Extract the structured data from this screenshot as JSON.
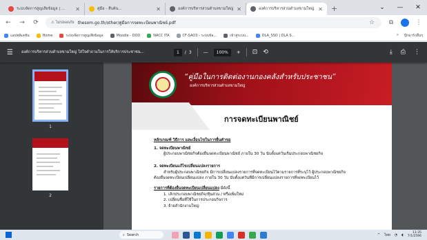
{
  "tabs": [
    {
      "title": "ระบบจัดการสูญเสียข้อมูล | ...",
      "color": "#e8453c",
      "active": false
    },
    {
      "title": "คู่มือ - สืบค้น...",
      "color": "#fbbc04",
      "active": false
    },
    {
      "title": "องค์การบริหารส่วนตำบลขามใหญ่ ...",
      "color": "#5f6368",
      "active": false
    },
    {
      "title": "องค์การบริหารส่วนตำบลขามใหญ่ ...",
      "color": "#5f6368",
      "active": true
    }
  ],
  "new_tab_glyph": "+",
  "window_controls": {
    "minimize": "⌄",
    "maximize": "—",
    "close": "✕"
  },
  "nav": {
    "back": "←",
    "forward": "→",
    "reload": "⟳",
    "secure_label": "⚠ ไม่ปลอดภัย",
    "url": "thesom.go.th/other/คู่มือการจดทะเบียนพาณิชย์.pdf",
    "star": "☆",
    "extensions": "⧉",
    "menu": "⋮"
  },
  "bookmarks": {
    "items": [
      {
        "label": "แอปพลิเคชัน",
        "color": "#4285f4"
      },
      {
        "label": "Home",
        "color": "#fbbc04"
      },
      {
        "label": "ระบบจัดการสูญเสียข้อมูล",
        "color": "#e8453c"
      },
      {
        "label": "Moodle - DOD",
        "color": "#5f6368"
      },
      {
        "label": "NACC ITA",
        "color": "#34a853"
      },
      {
        "label": "CF-SAO3 - ระบบข้อ...",
        "color": "#9aa0a6"
      },
      {
        "label": "เข้าสู่ระบบ...",
        "color": "#5f6368"
      },
      {
        "label": "DLA_SSO | DLA S...",
        "color": "#4285f4"
      }
    ],
    "more": "»",
    "other": "บุ๊กมาร์กอื่นๆ"
  },
  "pdf_toolbar": {
    "menu": "☰",
    "title": "องค์การบริหารส่วนตำบลขามใหญ่ ใส่ใจคำถามในการให้บริการประชาชน...",
    "page_current": "1",
    "page_sep": "/",
    "page_total": "3",
    "zoom_out": "—",
    "zoom": "100%",
    "zoom_in": "+",
    "fit": "⊡",
    "rotate": "⟲",
    "download": "⤓",
    "print": "⎙",
    "more": "⋮"
  },
  "thumbnails": [
    {
      "number": "1"
    },
    {
      "number": "2"
    }
  ],
  "document": {
    "banner_title": "“คู่มือในการติดต่องานกองคลังสำหรับประชาชน”",
    "banner_subtitle": "องค์การบริหารส่วนตำบลขามใหญ่",
    "section_title": "การจดทะเบียนพาณิชย์",
    "heading": "หลักเกณฑ์ วิธีการ และเงื่อนไขในการยื่นคำขอ",
    "item1_title": "1. จดทะเบียนพาณิชย์",
    "item1_text": "ผู้ประกอบพาณิชยกิจต้องยื่นจดทะเบียนพาณิชย์ ภายใน 30 วัน นับตั้งแต่วันเริ่มประกอบพาณิชยกิจ",
    "item2_title": "2. จดทะเบียนแก้ไขเปลี่ยนแปลงรายการ",
    "item2_line1": "สำหรับผู้ประกอบพาณิชยกิจ มีการเปลี่ยนแปลงรายการที่จดทะเบียนไว้ตามรายการที่ระบุไว้ ผู้ประกอบพาณิชยกิจ",
    "item2_line2": "ต้องยื่นจดทะเบียนเปลี่ยนแปลง ภายใน 30 วัน นับตั้งแต่วันที่มีการเปลี่ยนแปลงรายการที่จดทะเบียนไว้",
    "list_heading": "รายการที่ต้องยื่นจดทะเบียนเปลี่ยนแปลง",
    "list_suffix": " มีดังนี้",
    "list": [
      "1. เลิกประกอบพาณิชยกิจ/หุ้นส่วน / หรือเพิ่มใหม่",
      "2. เปลี่ยนชื่อที่ใช้ในการประกอบกิจการ",
      "3. ย้ายสำนักงานใหญ่"
    ]
  },
  "taskbar": {
    "search_label": "Search",
    "apps": [
      "#f2a3b3",
      "#2b579a",
      "#0078d4",
      "#4285f4",
      "#d93025",
      "#f4b400",
      "#0f9d58",
      "#34a853",
      "#c81d25",
      "#2b7cd3"
    ],
    "tray_lang": "ไทย",
    "time": "11:35",
    "date": "7/1/2566"
  }
}
